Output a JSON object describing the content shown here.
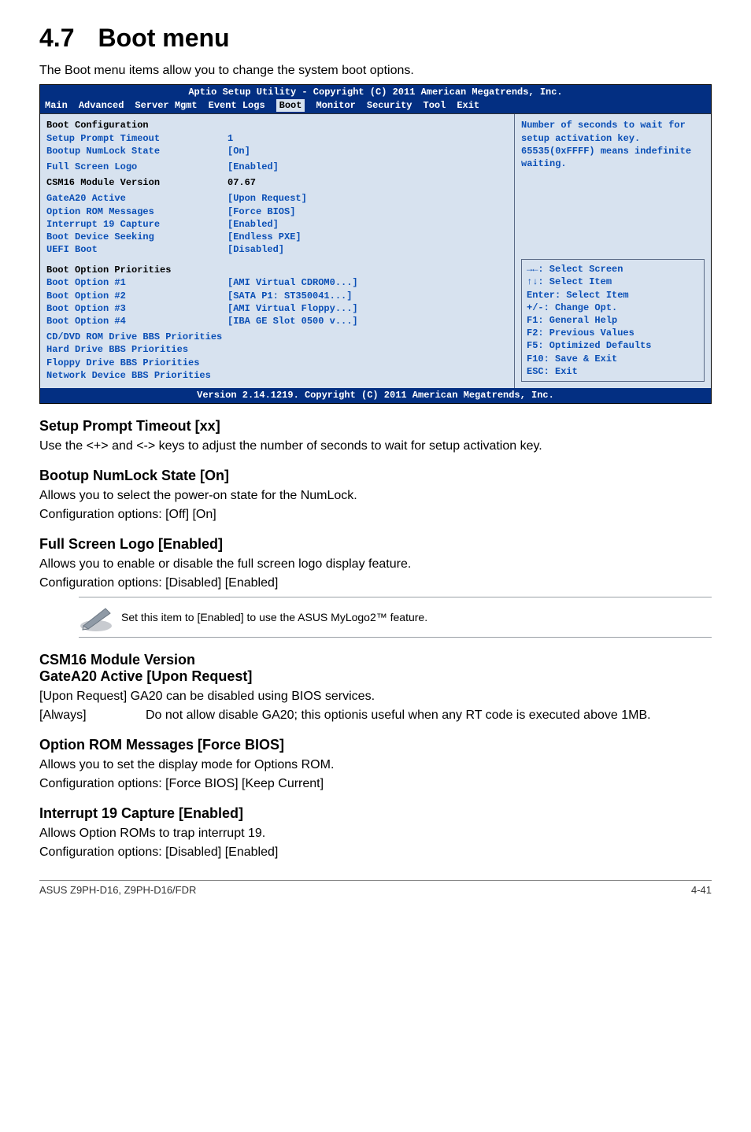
{
  "heading": {
    "number": "4.7",
    "title": "Boot menu"
  },
  "intro": "The Boot menu items allow you to change the system boot options.",
  "bios": {
    "titlebar": "Aptio Setup Utility - Copyright (C) 2011 American Megatrends, Inc.",
    "tabs": [
      "Main",
      "Advanced",
      "Server Mgmt",
      "Event Logs",
      "Boot",
      "Monitor",
      "Security",
      "Tool",
      "Exit"
    ],
    "active_tab": "Boot",
    "section1_heading": "Boot Configuration",
    "rows1": [
      {
        "label": "Setup Prompt Timeout",
        "value": "1"
      },
      {
        "label": "Bootup NumLock State",
        "value": "[On]"
      }
    ],
    "rows1b": [
      {
        "label": "Full Screen Logo",
        "value": "[Enabled]"
      }
    ],
    "rows_heading": {
      "label": "CSM16 Module Version",
      "value": " 07.67"
    },
    "rows2": [
      {
        "label": "GateA20 Active",
        "value": "[Upon Request]"
      },
      {
        "label": "Option ROM Messages",
        "value": "[Force BIOS]"
      },
      {
        "label": "Interrupt 19 Capture",
        "value": "[Enabled]"
      },
      {
        "label": "Boot Device Seeking",
        "value": "[Endless PXE]"
      },
      {
        "label": "UEFI Boot",
        "value": "[Disabled]"
      }
    ],
    "section2_heading": "Boot Option Priorities",
    "rows3": [
      {
        "label": "Boot Option #1",
        "value": "[AMI Virtual CDROM0...]"
      },
      {
        "label": "Boot Option #2",
        "value": "[SATA  P1: ST350041...]"
      },
      {
        "label": "Boot Option #3",
        "value": "[AMI Virtual Floppy...]"
      },
      {
        "label": "Boot Option #4",
        "value": "[IBA GE Slot 0500 v...]"
      }
    ],
    "links": [
      "CD/DVD ROM Drive BBS Priorities",
      "Hard Drive BBS Priorities",
      "Floppy Drive BBS Priorities",
      "Network Device BBS Priorities"
    ],
    "help": "Number of seconds to wait for setup activation key. 65535(0xFFFF) means indefinite waiting.",
    "keys": [
      "→←: Select Screen",
      "↑↓:  Select Item",
      "Enter: Select Item",
      "+/-: Change Opt.",
      "F1: General Help",
      "F2: Previous Values",
      "F5: Optimized Defaults",
      "F10: Save & Exit",
      "ESC: Exit"
    ],
    "footer": "Version 2.14.1219. Copyright (C) 2011 American Megatrends, Inc."
  },
  "sections": {
    "spt": {
      "title": "Setup Prompt Timeout [xx]",
      "body": "Use the <+> and <-> keys to adjust the number of seconds to wait for setup activation key."
    },
    "numlock": {
      "title": "Bootup NumLock State [On]",
      "body1": "Allows you to select the power-on state for the NumLock.",
      "body2": "Configuration options: [Off] [On]"
    },
    "logo": {
      "title": "Full Screen Logo [Enabled]",
      "body1": "Allows you to enable or disable the full screen logo display feature.",
      "body2": "Configuration options: [Disabled] [Enabled]",
      "note": "Set this item to [Enabled] to use the ASUS MyLogo2™ feature."
    },
    "csm_gatea20": {
      "line1": "CSM16 Module Version",
      "line2": "GateA20 Active [Upon Request]",
      "body1": "[Upon Request] GA20 can be disabled using BIOS services.",
      "always_term": "[Always]",
      "always_def": "Do not allow disable GA20; this optionis useful when any RT code is executed above 1MB."
    },
    "optrom": {
      "title": "Option ROM Messages [Force BIOS]",
      "body1": "Allows you to set the display mode for Options ROM.",
      "body2": "Configuration options: [Force BIOS] [Keep Current]"
    },
    "int19": {
      "title": "Interrupt 19 Capture [Enabled]",
      "body1": "Allows Option ROMs to trap interrupt 19.",
      "body2": "Configuration options: [Disabled] [Enabled]"
    }
  },
  "footer": {
    "left": "ASUS Z9PH-D16, Z9PH-D16/FDR",
    "right": "4-41"
  }
}
